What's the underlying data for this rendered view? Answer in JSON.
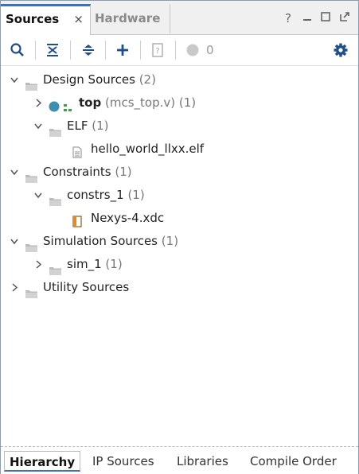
{
  "tabs": {
    "sources": "Sources",
    "close": "×",
    "hardware": "Hardware"
  },
  "window_controls": {
    "help": "?",
    "minimize": "—",
    "maximize": "☐",
    "float": "⇱"
  },
  "toolbar": {
    "count": "0"
  },
  "tree": {
    "design_sources": {
      "label": "Design Sources",
      "count": "(2)"
    },
    "top": {
      "label": "top",
      "file": "(mcs_top.v)",
      "count": "(1)"
    },
    "elf": {
      "label": "ELF",
      "count": "(1)"
    },
    "elf_file": {
      "label": "hello_world_llxx.elf"
    },
    "constraints": {
      "label": "Constraints",
      "count": "(1)"
    },
    "constrs_1": {
      "label": "constrs_1",
      "count": "(1)"
    },
    "xdc": {
      "label": "Nexys-4.xdc"
    },
    "simulation_sources": {
      "label": "Simulation Sources",
      "count": "(1)"
    },
    "sim_1": {
      "label": "sim_1",
      "count": "(1)"
    },
    "utility_sources": {
      "label": "Utility Sources"
    }
  },
  "bottom_tabs": {
    "hierarchy": "Hierarchy",
    "ip_sources": "IP Sources",
    "libraries": "Libraries",
    "compile_order": "Compile Order"
  },
  "colors": {
    "accent": "#3f70c0",
    "toolbar_icon": "#1e4e8c",
    "status_dot": "#3d8fb0",
    "folder": "#b9b9b9",
    "hier_icon": "#3aa04a"
  }
}
